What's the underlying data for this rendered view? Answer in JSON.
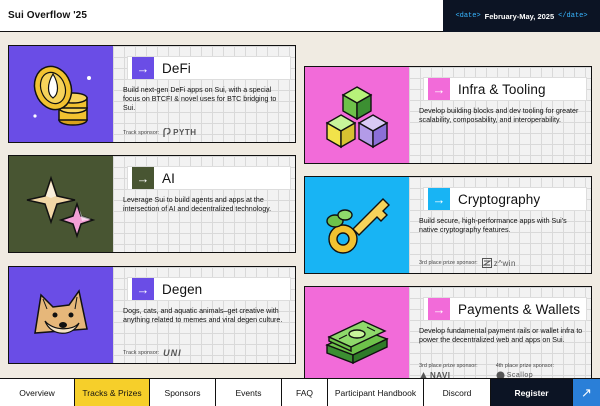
{
  "header": {
    "brand": "Sui Overflow '25",
    "date_open_tag": "<date>",
    "date_text": "February-May, 2025",
    "date_close_tag": "</date>"
  },
  "tracks": [
    {
      "title": "DeFi",
      "description": "Build next-gen DeFi apps on Sui, with a special focus on BTCFI & novel uses for BTC bridging to Sui.",
      "sponsor_label": "Track sponsor:",
      "sponsor_name": "PYTH",
      "art_color": "#6a4de6",
      "arrow_color": "#6a4de6"
    },
    {
      "title": "AI",
      "description": "Leverage Sui to build agents and apps at the intersection of AI and decentralized technology.",
      "art_color": "#485532",
      "arrow_color": "#485532"
    },
    {
      "title": "Degen",
      "description": "Dogs, cats, and aquatic animals–get creative with anything related to memes and viral degen culture.",
      "sponsor_label": "Track sponsor:",
      "sponsor_name": "UNI",
      "art_color": "#6a4de6",
      "arrow_color": "#6a4de6"
    },
    {
      "title": "Infra & Tooling",
      "description": "Develop building blocks and dev tooling for greater scalability, composability, and interoperability.",
      "art_color": "#f26bd9",
      "arrow_color": "#f26bd9"
    },
    {
      "title": "Cryptography",
      "description": "Build secure, high-performance apps with Sui's native cryptography features.",
      "sponsor_label": "3rd place prize sponsor:",
      "sponsor_name": "z^win",
      "art_color": "#18b4f4",
      "arrow_color": "#18b4f4"
    },
    {
      "title": "Payments & Wallets",
      "description": "Develop fundamental payment rails or wallet infra to power the decentralized web and apps on Sui.",
      "sponsor_label": "3rd place prize sponsor:",
      "sponsor_name": "NAVI",
      "sponsor2_label": "4th place prize sponsor:",
      "sponsor2_name": "Scallop",
      "art_color": "#f26bd9",
      "arrow_color": "#f26bd9"
    }
  ],
  "nav": {
    "items": [
      "Overview",
      "Tracks & Prizes",
      "Sponsors",
      "Events",
      "FAQ",
      "Participant Handbook",
      "Discord"
    ],
    "active_index": 1,
    "register_label": "Register",
    "go_icon": "↗"
  },
  "icons": {
    "arrow": "→",
    "track_art": [
      "coins-art",
      "sparkle-art",
      "doge-art",
      "cubes-art",
      "key-art",
      "money-stack-art"
    ],
    "sponsor_logos": [
      "pyth-logo",
      "uni-logo",
      "zkwin-logo",
      "navi-logo",
      "scallop-logo"
    ]
  }
}
